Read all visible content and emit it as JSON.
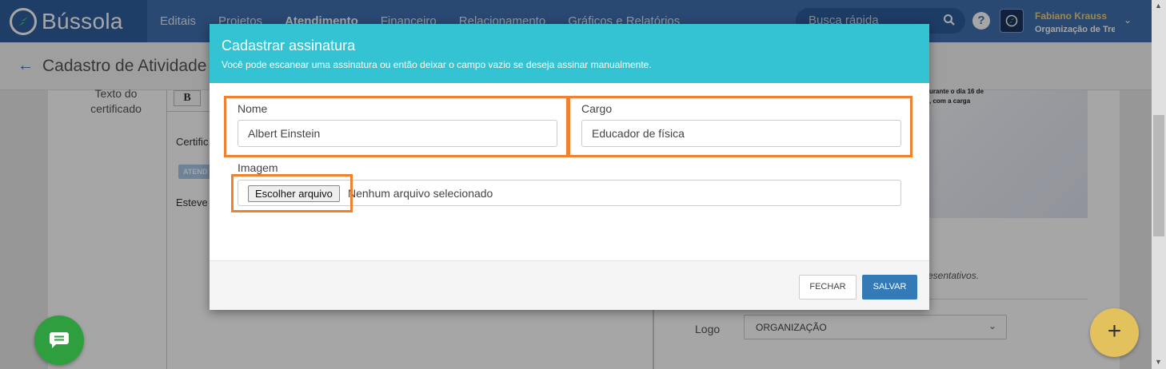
{
  "app": {
    "brand": "Bússola"
  },
  "nav": {
    "items": [
      "Editais",
      "Projetos",
      "Atendimento",
      "Financeiro",
      "Relacionamento",
      "Gráficos e Relatórios"
    ],
    "active": "Atendimento"
  },
  "search": {
    "placeholder": "Busca rápida",
    "icon": "search-icon"
  },
  "user": {
    "name": "Fabiano Krauss",
    "org": "Organização de Tre"
  },
  "page": {
    "title": "Cadastro de Atividade"
  },
  "background": {
    "label": "Texto do certificado",
    "bold_button": "B",
    "editor_line1": "Certific",
    "tag": "ATEND",
    "editor_line2": "Esteve",
    "preview_text1": "urante o  dia 16 de",
    "preview_text2": ", com a carga",
    "italic_note": "esentativos.",
    "logo_label": "Logo",
    "logo_value": "ORGANIZAÇÃO"
  },
  "modal": {
    "title": "Cadastrar assinatura",
    "subtitle": "Você pode escanear uma assinatura ou então deixar o campo vazio se deseja assinar manualmente.",
    "fields": {
      "nome": {
        "label": "Nome",
        "value": "Albert Einstein"
      },
      "cargo": {
        "label": "Cargo",
        "value": "Educador de física"
      },
      "imagem": {
        "label": "Imagem",
        "button": "Escolher arquivo",
        "status": "Nenhum arquivo selecionado"
      }
    },
    "buttons": {
      "close": "FECHAR",
      "save": "SALVAR"
    }
  },
  "colors": {
    "nav": "#3f6fb0",
    "modal_header": "#33c3d3",
    "highlight": "#f0822f",
    "save": "#337ab7",
    "chat": "#2e9e3e",
    "fab": "#e3c15d"
  }
}
